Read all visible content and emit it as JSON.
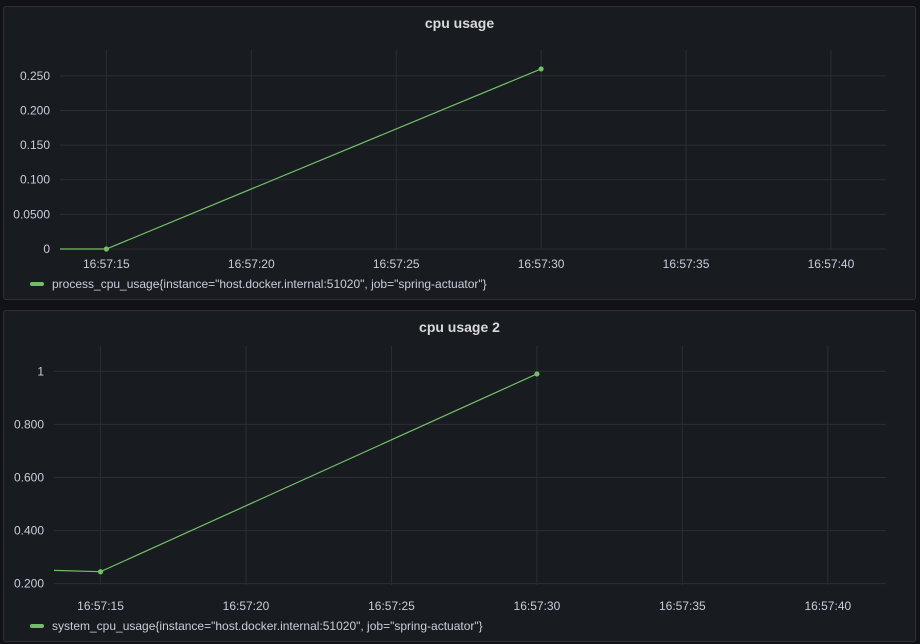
{
  "colors": {
    "series": "#73bf69",
    "grid": "#2b2e35"
  },
  "chart_data": [
    {
      "type": "line",
      "title": "cpu usage",
      "xlabel": "",
      "ylabel": "",
      "x_ticks": [
        "16:57:15",
        "16:57:20",
        "16:57:25",
        "16:57:30",
        "16:57:35",
        "16:57:40"
      ],
      "y_ticks": [
        "0",
        "0.0500",
        "0.100",
        "0.150",
        "0.200",
        "0.250"
      ],
      "y_tick_values": [
        0,
        0.05,
        0.1,
        0.15,
        0.2,
        0.25
      ],
      "xlim": [
        "16:57:13.4",
        "16:57:41.9"
      ],
      "ylim": [
        0,
        0.27
      ],
      "grid": true,
      "legend_position": "bottom-left",
      "series": [
        {
          "name": "process_cpu_usage{instance=\"host.docker.internal:51020\", job=\"spring-actuator\"}",
          "x": [
            "16:57:13.4",
            "16:57:15",
            "16:57:30"
          ],
          "y": [
            0,
            0,
            0.26
          ],
          "points": [
            false,
            true,
            true
          ]
        }
      ]
    },
    {
      "type": "line",
      "title": "cpu usage 2",
      "xlabel": "",
      "ylabel": "",
      "x_ticks": [
        "16:57:15",
        "16:57:20",
        "16:57:25",
        "16:57:30",
        "16:57:35",
        "16:57:40"
      ],
      "y_ticks": [
        "0.200",
        "0.400",
        "0.600",
        "0.800",
        "1"
      ],
      "y_tick_values": [
        0.2,
        0.4,
        0.6,
        0.8,
        1.0
      ],
      "xlim": [
        "16:57:13.4",
        "16:57:42.0"
      ],
      "ylim": [
        0.195,
        1.05
      ],
      "grid": true,
      "legend_position": "bottom-left",
      "series": [
        {
          "name": "system_cpu_usage{instance=\"host.docker.internal:51020\", job=\"spring-actuator\"}",
          "x": [
            "16:57:13.4",
            "16:57:15",
            "16:57:30"
          ],
          "y": [
            0.25,
            0.245,
            0.99
          ],
          "points": [
            false,
            true,
            true
          ]
        }
      ]
    }
  ]
}
